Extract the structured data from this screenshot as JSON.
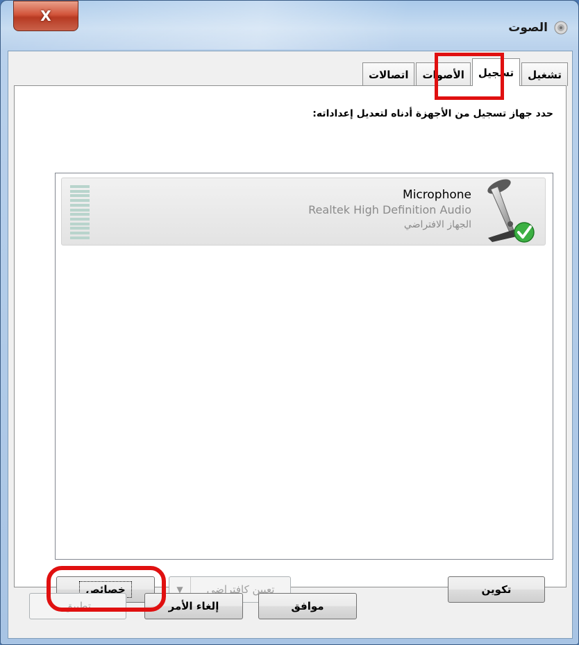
{
  "window": {
    "title": "الصوت",
    "close_label": "X",
    "title_icon": "speaker-icon"
  },
  "tabs": [
    {
      "label": "تشغيل",
      "active": false
    },
    {
      "label": "تسجيل",
      "active": true
    },
    {
      "label": "الأصوات",
      "active": false
    },
    {
      "label": "اتصالات",
      "active": false
    }
  ],
  "panel": {
    "instruction": "حدد جهاز تسجيل من الأجهزة أدناه لتعديل إعداداته:"
  },
  "devices": [
    {
      "name": "Microphone",
      "driver": "Realtek High Definition Audio",
      "status": "الجهاز الافتراضي",
      "icon": "microphone-icon",
      "badge": "green-check-icon"
    }
  ],
  "buttons": {
    "configure": "تكوين",
    "set_default": "تعيين كافتراضي",
    "properties": "خصائص",
    "ok": "موافق",
    "cancel": "إلغاء الأمر",
    "apply": "تطبيق"
  },
  "colors": {
    "highlight": "#e01010",
    "check_green": "#3cb043"
  }
}
